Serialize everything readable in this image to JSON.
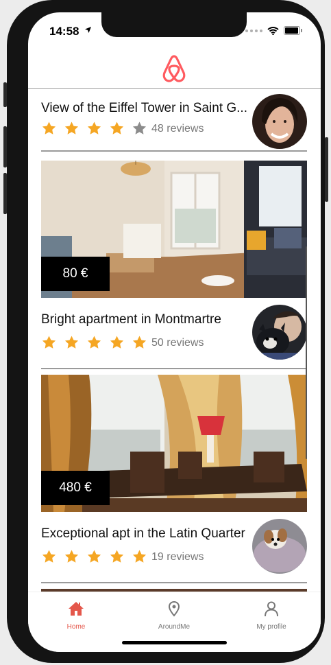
{
  "status_bar": {
    "time": "14:58"
  },
  "brand": {
    "accent": "#e4574b",
    "logo_color": "#ff5a5f",
    "star_color": "#f5a623",
    "star_empty_color": "#8c8c8c"
  },
  "listings": [
    {
      "title": "View of the Eiffel Tower in Saint G...",
      "rating": 4,
      "reviews": "48 reviews",
      "price": ""
    },
    {
      "title": "Bright apartment in Montmartre",
      "rating": 5,
      "reviews": "50 reviews",
      "price": "80 €"
    },
    {
      "title": "Exceptional apt in the Latin Quarter",
      "rating": 5,
      "reviews": "19 reviews",
      "price": "480 €"
    }
  ],
  "tabbar": {
    "items": [
      {
        "label": "Home",
        "icon": "home-icon",
        "active": true
      },
      {
        "label": "AroundMe",
        "icon": "map-pin-icon",
        "active": false
      },
      {
        "label": "My profile",
        "icon": "user-icon",
        "active": false
      }
    ]
  }
}
